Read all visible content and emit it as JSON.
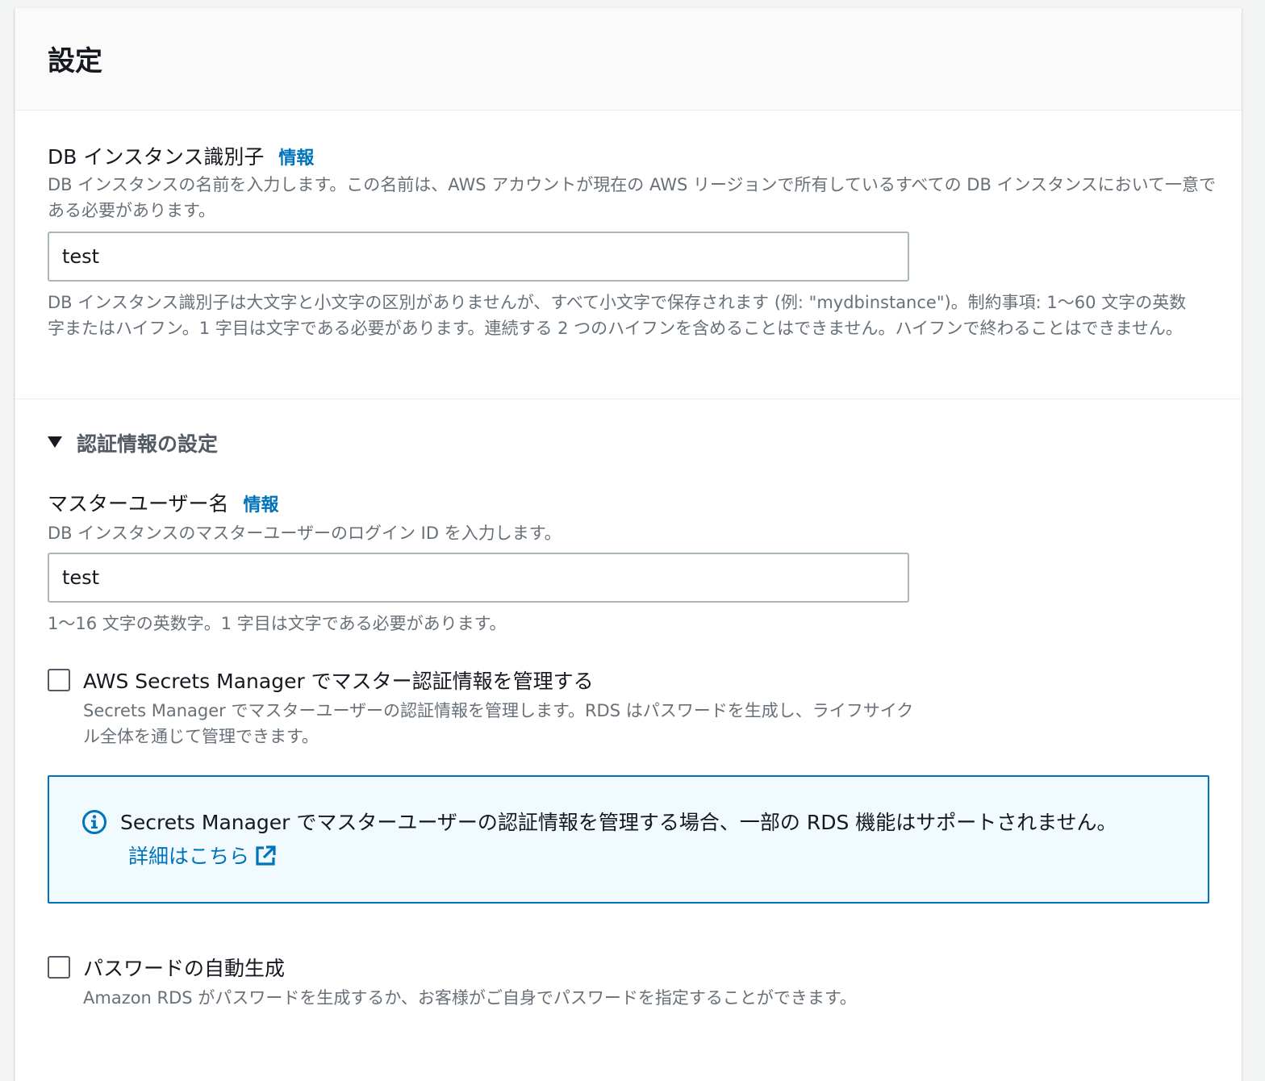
{
  "panel": {
    "title": "設定"
  },
  "db_identifier": {
    "label": "DB インスタンス識別子",
    "info": "情報",
    "description": "DB インスタンスの名前を入力します。この名前は、AWS アカウントが現在の AWS リージョンで所有しているすべての DB インスタンスにおいて一意である必要があります。",
    "value": "test",
    "constraint": "DB インスタンス識別子は大文字と小文字の区別がありませんが、すべて小文字で保存されます (例: \"mydbinstance\")。制約事項: 1〜60 文字の英数字またはハイフン。1 字目は文字である必要があります。連続する 2 つのハイフンを含めることはできません。ハイフンで終わることはできません。"
  },
  "credentials": {
    "section_title": "認証情報の設定",
    "master_username": {
      "label": "マスターユーザー名",
      "info": "情報",
      "description": "DB インスタンスのマスターユーザーのログイン ID を入力します。",
      "value": "test",
      "constraint": "1〜16 文字の英数字。1 字目は文字である必要があります。"
    },
    "secrets_manager": {
      "label": "AWS Secrets Manager でマスター認証情報を管理する",
      "description": "Secrets Manager でマスターユーザーの認証情報を管理します。RDS はパスワードを生成し、ライフサイクル全体を通じて管理できます。",
      "checked": false
    },
    "alert": {
      "icon": "info-circle-icon",
      "text": "Secrets Manager でマスターユーザーの認証情報を管理する場合、一部の RDS 機能はサポートされません。",
      "link": "詳細はこちら",
      "link_icon": "external-link-icon"
    },
    "auto_password": {
      "label": "パスワードの自動生成",
      "description": "Amazon RDS がパスワードを生成するか、お客様がご自身でパスワードを指定することができます。",
      "checked": false
    }
  },
  "colors": {
    "link": "#0073bb",
    "alert_border": "#0073bb",
    "alert_background": "#f1faff",
    "muted_text": "#687078"
  }
}
